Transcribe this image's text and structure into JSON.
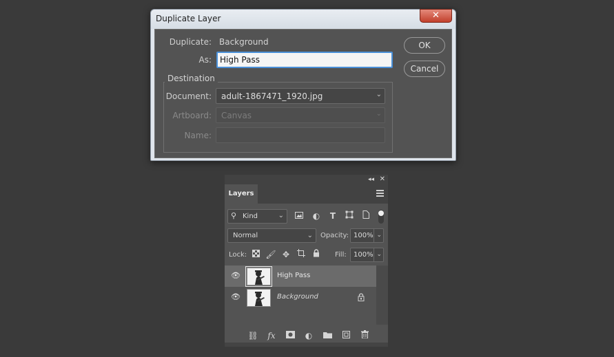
{
  "dialog": {
    "title": "Duplicate Layer",
    "close_symbol": "✕",
    "duplicate_label": "Duplicate:",
    "duplicate_value": "Background",
    "as_label": "As:",
    "as_value": "High Pass",
    "destination_legend": "Destination",
    "document_label": "Document:",
    "document_value": "adult-1867471_1920.jpg",
    "artboard_label": "Artboard:",
    "artboard_value": "Canvas",
    "name_label": "Name:",
    "ok_label": "OK",
    "cancel_label": "Cancel"
  },
  "layers_panel": {
    "tab_label": "Layers",
    "collapse_symbol": "◂◂",
    "close_symbol": "✕",
    "filter_kind": "Kind",
    "blend_mode": "Normal",
    "opacity_label": "Opacity:",
    "opacity_value": "100%",
    "lock_label": "Lock:",
    "fill_label": "Fill:",
    "fill_value": "100%",
    "layers": [
      {
        "name": "High Pass",
        "selected": true,
        "visible": true,
        "locked": false
      },
      {
        "name": "Background",
        "selected": false,
        "visible": true,
        "locked": true
      }
    ],
    "icons": {
      "filter": [
        "image-filter-icon",
        "adjustment-filter-icon",
        "type-filter-icon",
        "shape-filter-icon",
        "smart-object-filter-icon"
      ],
      "lock": [
        "lock-transparent-pixels-icon",
        "lock-image-pixels-icon",
        "lock-position-icon",
        "lock-artboard-icon",
        "lock-all-icon"
      ],
      "footer": [
        "link-layers-icon",
        "fx-icon",
        "add-mask-icon",
        "new-adjustment-layer-icon",
        "new-group-icon",
        "new-layer-icon",
        "delete-layer-icon"
      ]
    }
  },
  "colors": {
    "background": "#3a3a3a",
    "dialog_body": "#535353",
    "accent_focus": "#4a90d9",
    "close_button": "#c2402c",
    "selected_layer": "#6b6b6b"
  }
}
